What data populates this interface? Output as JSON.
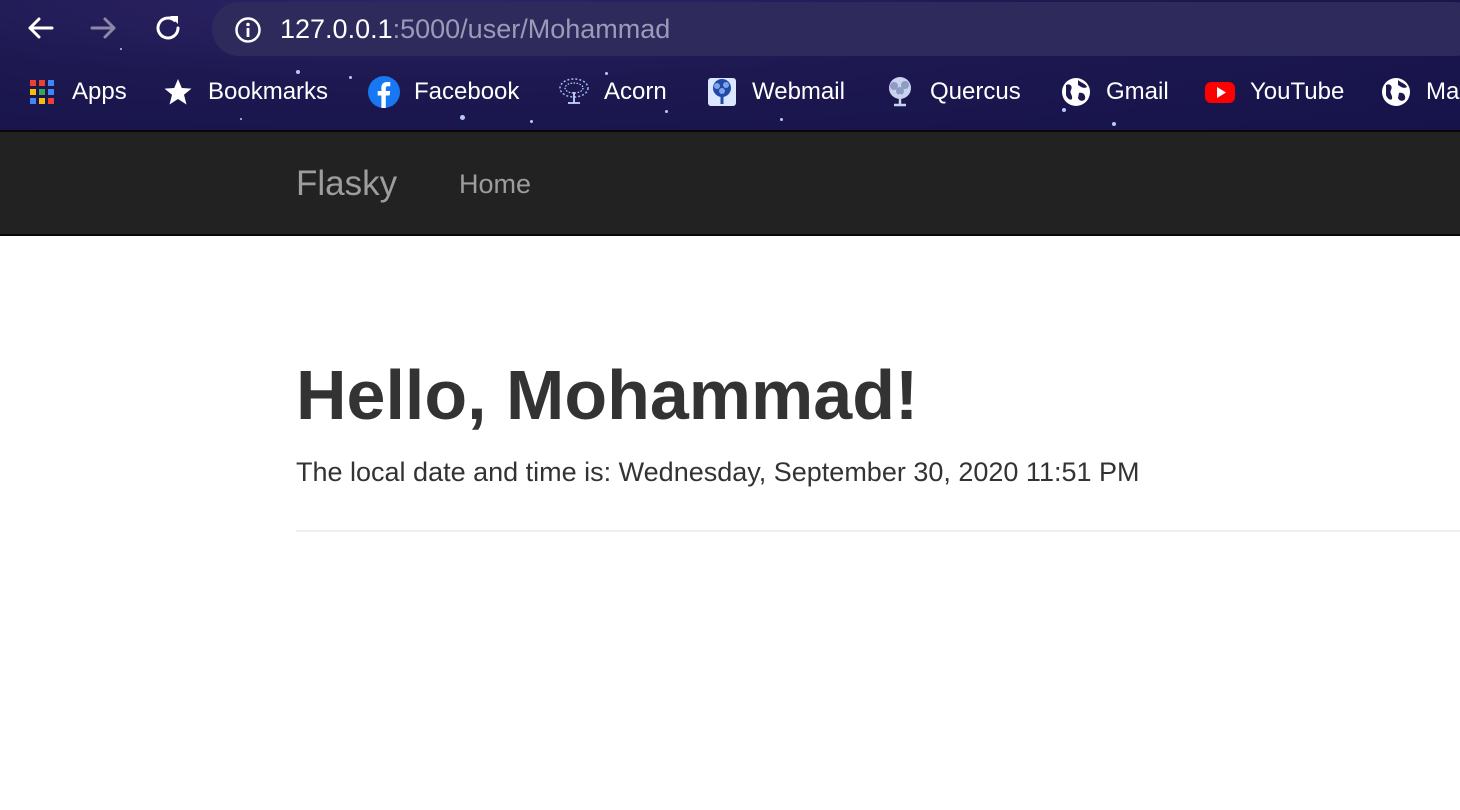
{
  "browser": {
    "url_host": "127.0.0.1",
    "url_rest": ":5000/user/Mohammad",
    "bookmarks": [
      {
        "label": "Apps",
        "icon": "apps-grid-icon"
      },
      {
        "label": "Bookmarks",
        "icon": "star-icon"
      },
      {
        "label": "Facebook",
        "icon": "facebook-icon"
      },
      {
        "label": "Acorn",
        "icon": "acorn-icon"
      },
      {
        "label": "Webmail",
        "icon": "webmail-icon"
      },
      {
        "label": "Quercus",
        "icon": "quercus-icon"
      },
      {
        "label": "Gmail",
        "icon": "globe-icon"
      },
      {
        "label": "YouTube",
        "icon": "youtube-icon"
      },
      {
        "label": "Ma",
        "icon": "globe-icon"
      }
    ]
  },
  "navbar": {
    "brand": "Flasky",
    "links": [
      {
        "label": "Home"
      }
    ]
  },
  "main": {
    "heading": "Hello, Mohammad!",
    "subtext": "The local date and time is: Wednesday, September 30, 2020 11:51 PM"
  },
  "colors": {
    "chrome_bg": "#1d1850",
    "navbar_bg": "#222222",
    "navbar_text": "#9d9d9d",
    "body_text": "#333333"
  }
}
